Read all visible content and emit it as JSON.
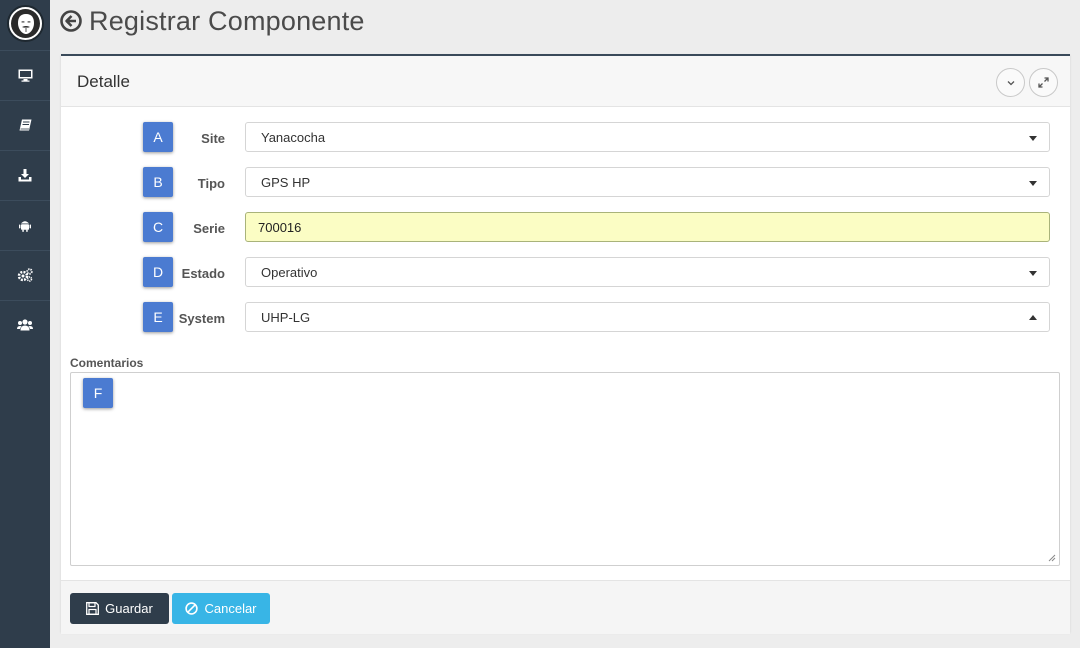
{
  "page": {
    "title": "Registrar Componente"
  },
  "sidebar": {
    "logo_icon": "anonymous-mask-logo",
    "items": [
      {
        "icon": "desktop-icon"
      },
      {
        "icon": "book-icon"
      },
      {
        "icon": "download-icon"
      },
      {
        "icon": "android-icon"
      },
      {
        "icon": "gears-icon"
      },
      {
        "icon": "users-icon"
      }
    ]
  },
  "panel": {
    "title": "Detalle",
    "tools": [
      "collapse-icon",
      "expand-icon"
    ]
  },
  "form": {
    "site": {
      "badge": "A",
      "label": "Site",
      "value": "Yanacocha"
    },
    "tipo": {
      "badge": "B",
      "label": "Tipo",
      "value": "GPS HP"
    },
    "serie": {
      "badge": "C",
      "label": "Serie",
      "value": "700016"
    },
    "estado": {
      "badge": "D",
      "label": "Estado",
      "value": "Operativo"
    },
    "system": {
      "badge": "E",
      "label": "System",
      "value": "UHP-LG"
    },
    "comentarios": {
      "badge": "F",
      "label": "Comentarios",
      "value": ""
    }
  },
  "footer": {
    "save_label": "Guardar",
    "cancel_label": "Cancelar"
  },
  "colors": {
    "sidebar": "#2f3d4b",
    "badge": "#4b7bd1",
    "highlight_input": "#fbfdc4",
    "cancel_button": "#38b5e6"
  }
}
